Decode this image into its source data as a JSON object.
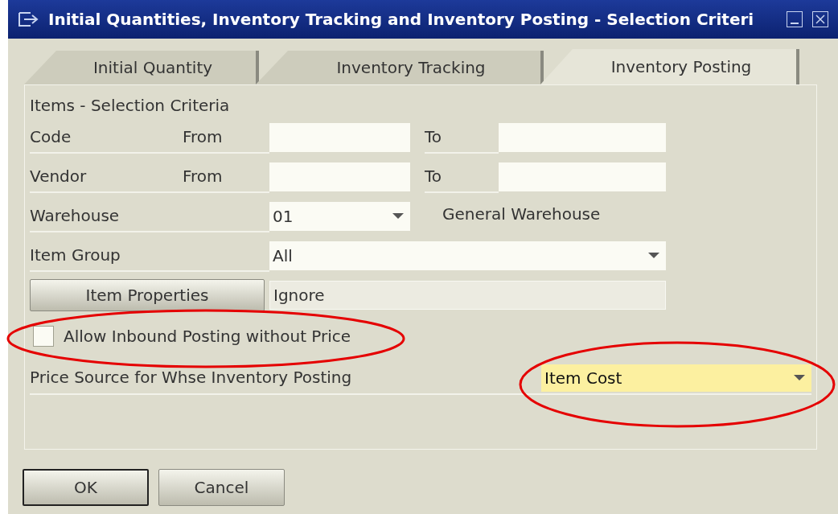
{
  "window": {
    "title": "Initial Quantities, Inventory Tracking and Inventory Posting - Selection Criteri"
  },
  "tabs": [
    {
      "label": "Initial Quantity",
      "selected": false
    },
    {
      "label": "Inventory Tracking",
      "selected": false
    },
    {
      "label": "Inventory Posting",
      "selected": true
    }
  ],
  "section_title": "Items - Selection Criteria",
  "range_rows": [
    {
      "label": "Code",
      "from_label": "From",
      "to_label": "To"
    },
    {
      "label": "Vendor",
      "from_label": "From",
      "to_label": "To"
    }
  ],
  "warehouse": {
    "label": "Warehouse",
    "value": "01",
    "description": "General Warehouse"
  },
  "item_group": {
    "label": "Item Group",
    "value": "All"
  },
  "item_properties": {
    "button": "Item Properties",
    "value": "Ignore"
  },
  "allow_inbound": {
    "label": "Allow Inbound Posting without Price",
    "checked": false
  },
  "price_source": {
    "label": "Price Source for Whse Inventory Posting",
    "value": "Item Cost"
  },
  "buttons": [
    {
      "label": "OK",
      "default": true
    },
    {
      "label": "Cancel",
      "default": false
    }
  ]
}
